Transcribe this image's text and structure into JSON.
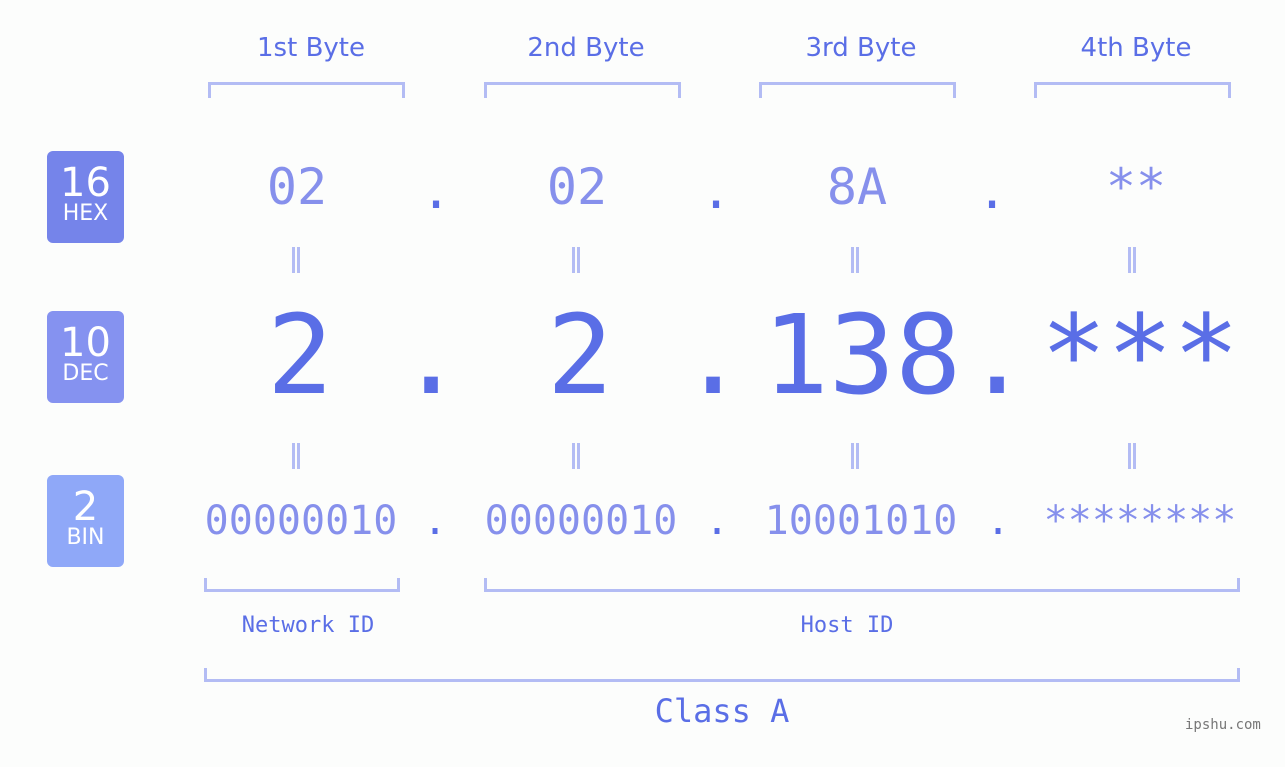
{
  "bytes": [
    {
      "header": "1st Byte",
      "hex": "02",
      "dec": "2",
      "bin": "00000010"
    },
    {
      "header": "2nd Byte",
      "hex": "02",
      "dec": "2",
      "bin": "00000010"
    },
    {
      "header": "3rd Byte",
      "hex": "8A",
      "dec": "138",
      "bin": "10001010"
    },
    {
      "header": "4th Byte",
      "hex": "**",
      "dec": "***",
      "bin": "********"
    }
  ],
  "separator": ".",
  "badges": {
    "hex": {
      "num": "16",
      "label": "HEX",
      "color": "#7584ea"
    },
    "dec": {
      "num": "10",
      "label": "DEC",
      "color": "#8592f0"
    },
    "bin": {
      "num": "2",
      "label": "BIN",
      "color": "#8fa8f8"
    }
  },
  "labels": {
    "network_id": "Network ID",
    "host_id": "Host ID",
    "class": "Class A"
  },
  "watermark": "ipshu.com",
  "colors": {
    "accent": "#5a6ee6",
    "light": "#8690ec",
    "bracket": "#b3bcf4"
  }
}
